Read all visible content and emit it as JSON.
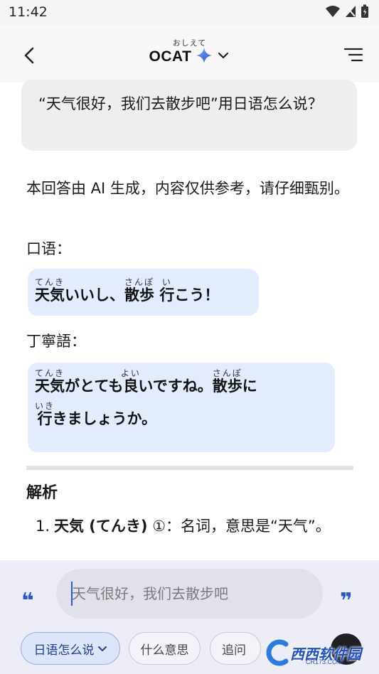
{
  "status_bar": {
    "time": "11:42"
  },
  "header": {
    "brand_ruby": "おしえて",
    "brand_name": "OCAT"
  },
  "user_message": "“天气很好，我们去散步吧”用日语怎么说？",
  "answer": {
    "intro": "本回答由 AI 生成，内容仅供参考，请仔细甄别。",
    "oral_label": "口语：",
    "oral": {
      "w1": "天気",
      "w1_ruby": "てんき",
      "w2": "いいし、",
      "w3": "散歩",
      "w3_ruby": "さんぽ",
      "w4": " ",
      "w5": "行",
      "w5_ruby": "い",
      "w6": "こう！"
    },
    "polite_label": "丁寧語：",
    "polite": {
      "w1": "天気",
      "w1_ruby": "てんき",
      "w2": "がとても",
      "w3": "良",
      "w3_ruby": "よい",
      "w4": "いですね。",
      "w5": "散歩",
      "w5_ruby": "さんぽ",
      "w6": "に",
      "w7": "行",
      "w7_ruby": "いき",
      "w8": "きましょうか。"
    },
    "section_title": "解析",
    "list_item_1": {
      "num": "1.",
      "term": "天気 (てんき)",
      "rest": " ①：名词，意思是“天气”。"
    }
  },
  "composer": {
    "placeholder": "天气很好，我们去散步吧",
    "chip_primary": "日语怎么说",
    "chip_2": "什么意思",
    "chip_3": "追问"
  },
  "watermark": {
    "text": "西西软件园",
    "sub": "CR173.COM"
  },
  "colors": {
    "accent": "#2a57d6",
    "bubble_bg": "#eeeeef",
    "jp_box_bg": "#e3ecfd"
  }
}
